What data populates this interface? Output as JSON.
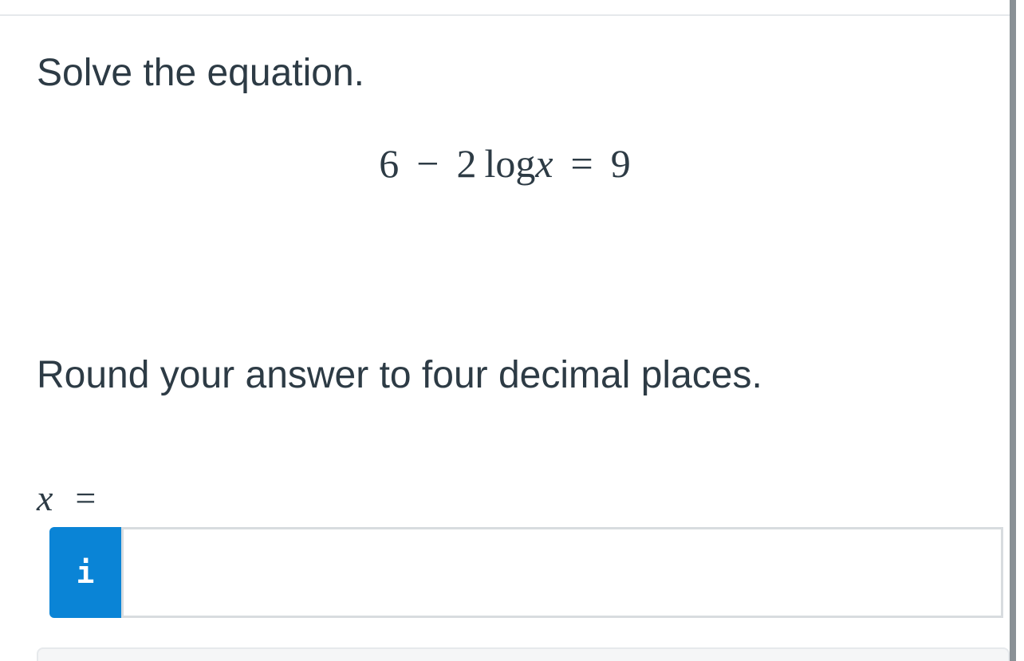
{
  "question": {
    "prompt": "Solve the equation.",
    "equation": {
      "lhs_constant": "6",
      "minus": "−",
      "coefficient": "2",
      "function": "log",
      "variable": "x",
      "equals": "=",
      "rhs": "9"
    },
    "instruction": "Round your answer to four decimal places."
  },
  "answer": {
    "variable": "x",
    "equals": "=",
    "info_button_icon": "info-icon",
    "info_button_glyph": "i",
    "input_value": "",
    "input_placeholder": ""
  },
  "colors": {
    "text": "#2d3b45",
    "info_button": "#0a84d6",
    "input_border": "#d8dcdf"
  }
}
